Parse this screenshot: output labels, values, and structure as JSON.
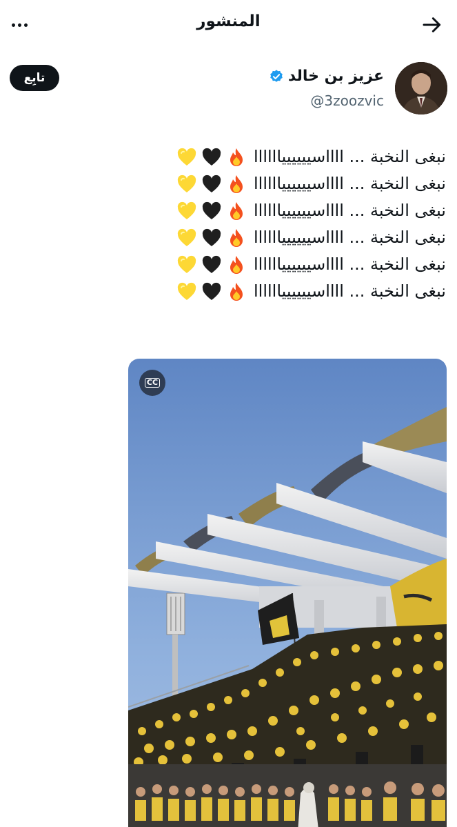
{
  "header": {
    "title": "المنشور",
    "back_icon": "arrow-right-icon",
    "more_icon": "more-horizontal-icon"
  },
  "author": {
    "display_name": "عزيز بن خالد",
    "handle": "@3zoozvic",
    "verified": true,
    "verified_color": "#1d9bf0",
    "follow_label": "تابِع"
  },
  "post": {
    "lines": [
      "نبغى النخبة ... ااااسيييييياااااا",
      "نبغى النخبة ... ااااسيييييياااااا",
      "نبغى النخبة ... ااااسيييييياااااا",
      "نبغى النخبة ... ااااسيييييياااااا",
      "نبغى النخبة ... ااااسيييييياااااا",
      "نبغى النخبة ... ااااسيييييياااااا"
    ],
    "line_emojis": [
      "fire-emoji",
      "black-heart-emoji",
      "yellow-heart-emoji"
    ]
  },
  "media": {
    "type": "video",
    "caption_badge": "CC",
    "description_icons": [
      "closed-captions-icon"
    ]
  },
  "colors": {
    "text": "#0f1419",
    "secondary_text": "#536471",
    "accent": "#1d9bf0",
    "button_bg": "#0f1419"
  }
}
